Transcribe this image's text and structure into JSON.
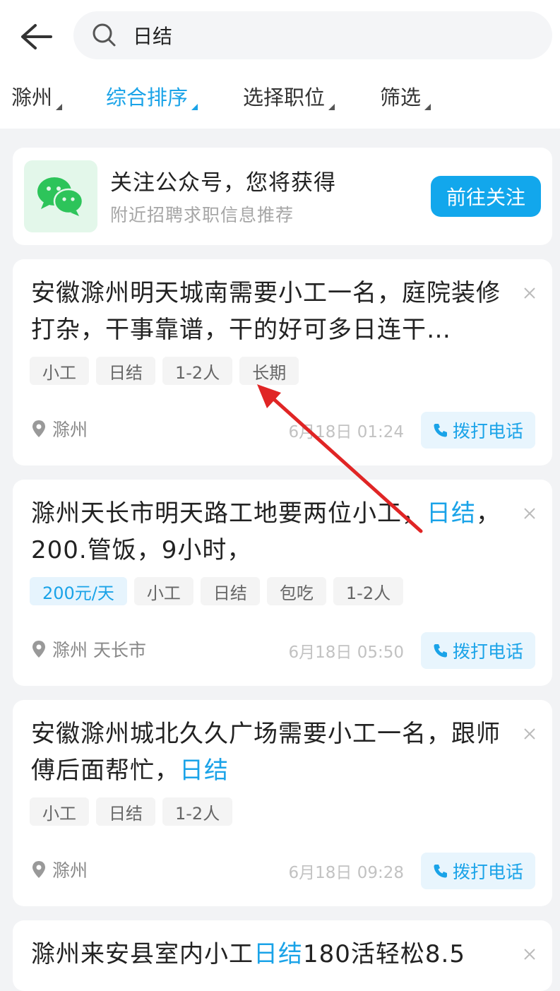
{
  "header": {
    "search_query": "日结",
    "filters": [
      "滁州",
      "综合排序",
      "选择职位",
      "筛选"
    ]
  },
  "banner": {
    "title": "关注公众号，您将获得",
    "subtitle": "附近招聘求职信息推荐",
    "button": "前往关注"
  },
  "jobs": [
    {
      "title_a": "安徽滁州明天城南需要小工一名，庭院装修打杂，干事靠谱，干的好可多日连干…",
      "title_hl": "",
      "title_b": "",
      "tags": [
        "小工",
        "日结",
        "1-2人",
        "长期"
      ],
      "location": "滁州",
      "time": "6月18日 01:24",
      "call": "拨打电话"
    },
    {
      "title_a": "滁州天长市明天路工地要两位小工，",
      "title_hl": "日结",
      "title_b": "，200.管饭，9小时，",
      "salary": "200元/天",
      "tags": [
        "小工",
        "日结",
        "包吃",
        "1-2人"
      ],
      "location": "滁州 天长市",
      "time": "6月18日 05:50",
      "call": "拨打电话"
    },
    {
      "title_a": "安徽滁州城北久久广场需要小工一名，跟师傅后面帮忙，",
      "title_hl": "日结",
      "title_b": "",
      "tags": [
        "小工",
        "日结",
        "1-2人"
      ],
      "location": "滁州",
      "time": "6月18日 09:28",
      "call": "拨打电话"
    },
    {
      "title_a": "滁州来安县室内小工",
      "title_hl": "日结",
      "title_b": "180活轻松8.5"
    }
  ],
  "colors": {
    "accent": "#1aa3e8",
    "button": "#12a7ec",
    "annotation_arrow": "#e02525"
  }
}
